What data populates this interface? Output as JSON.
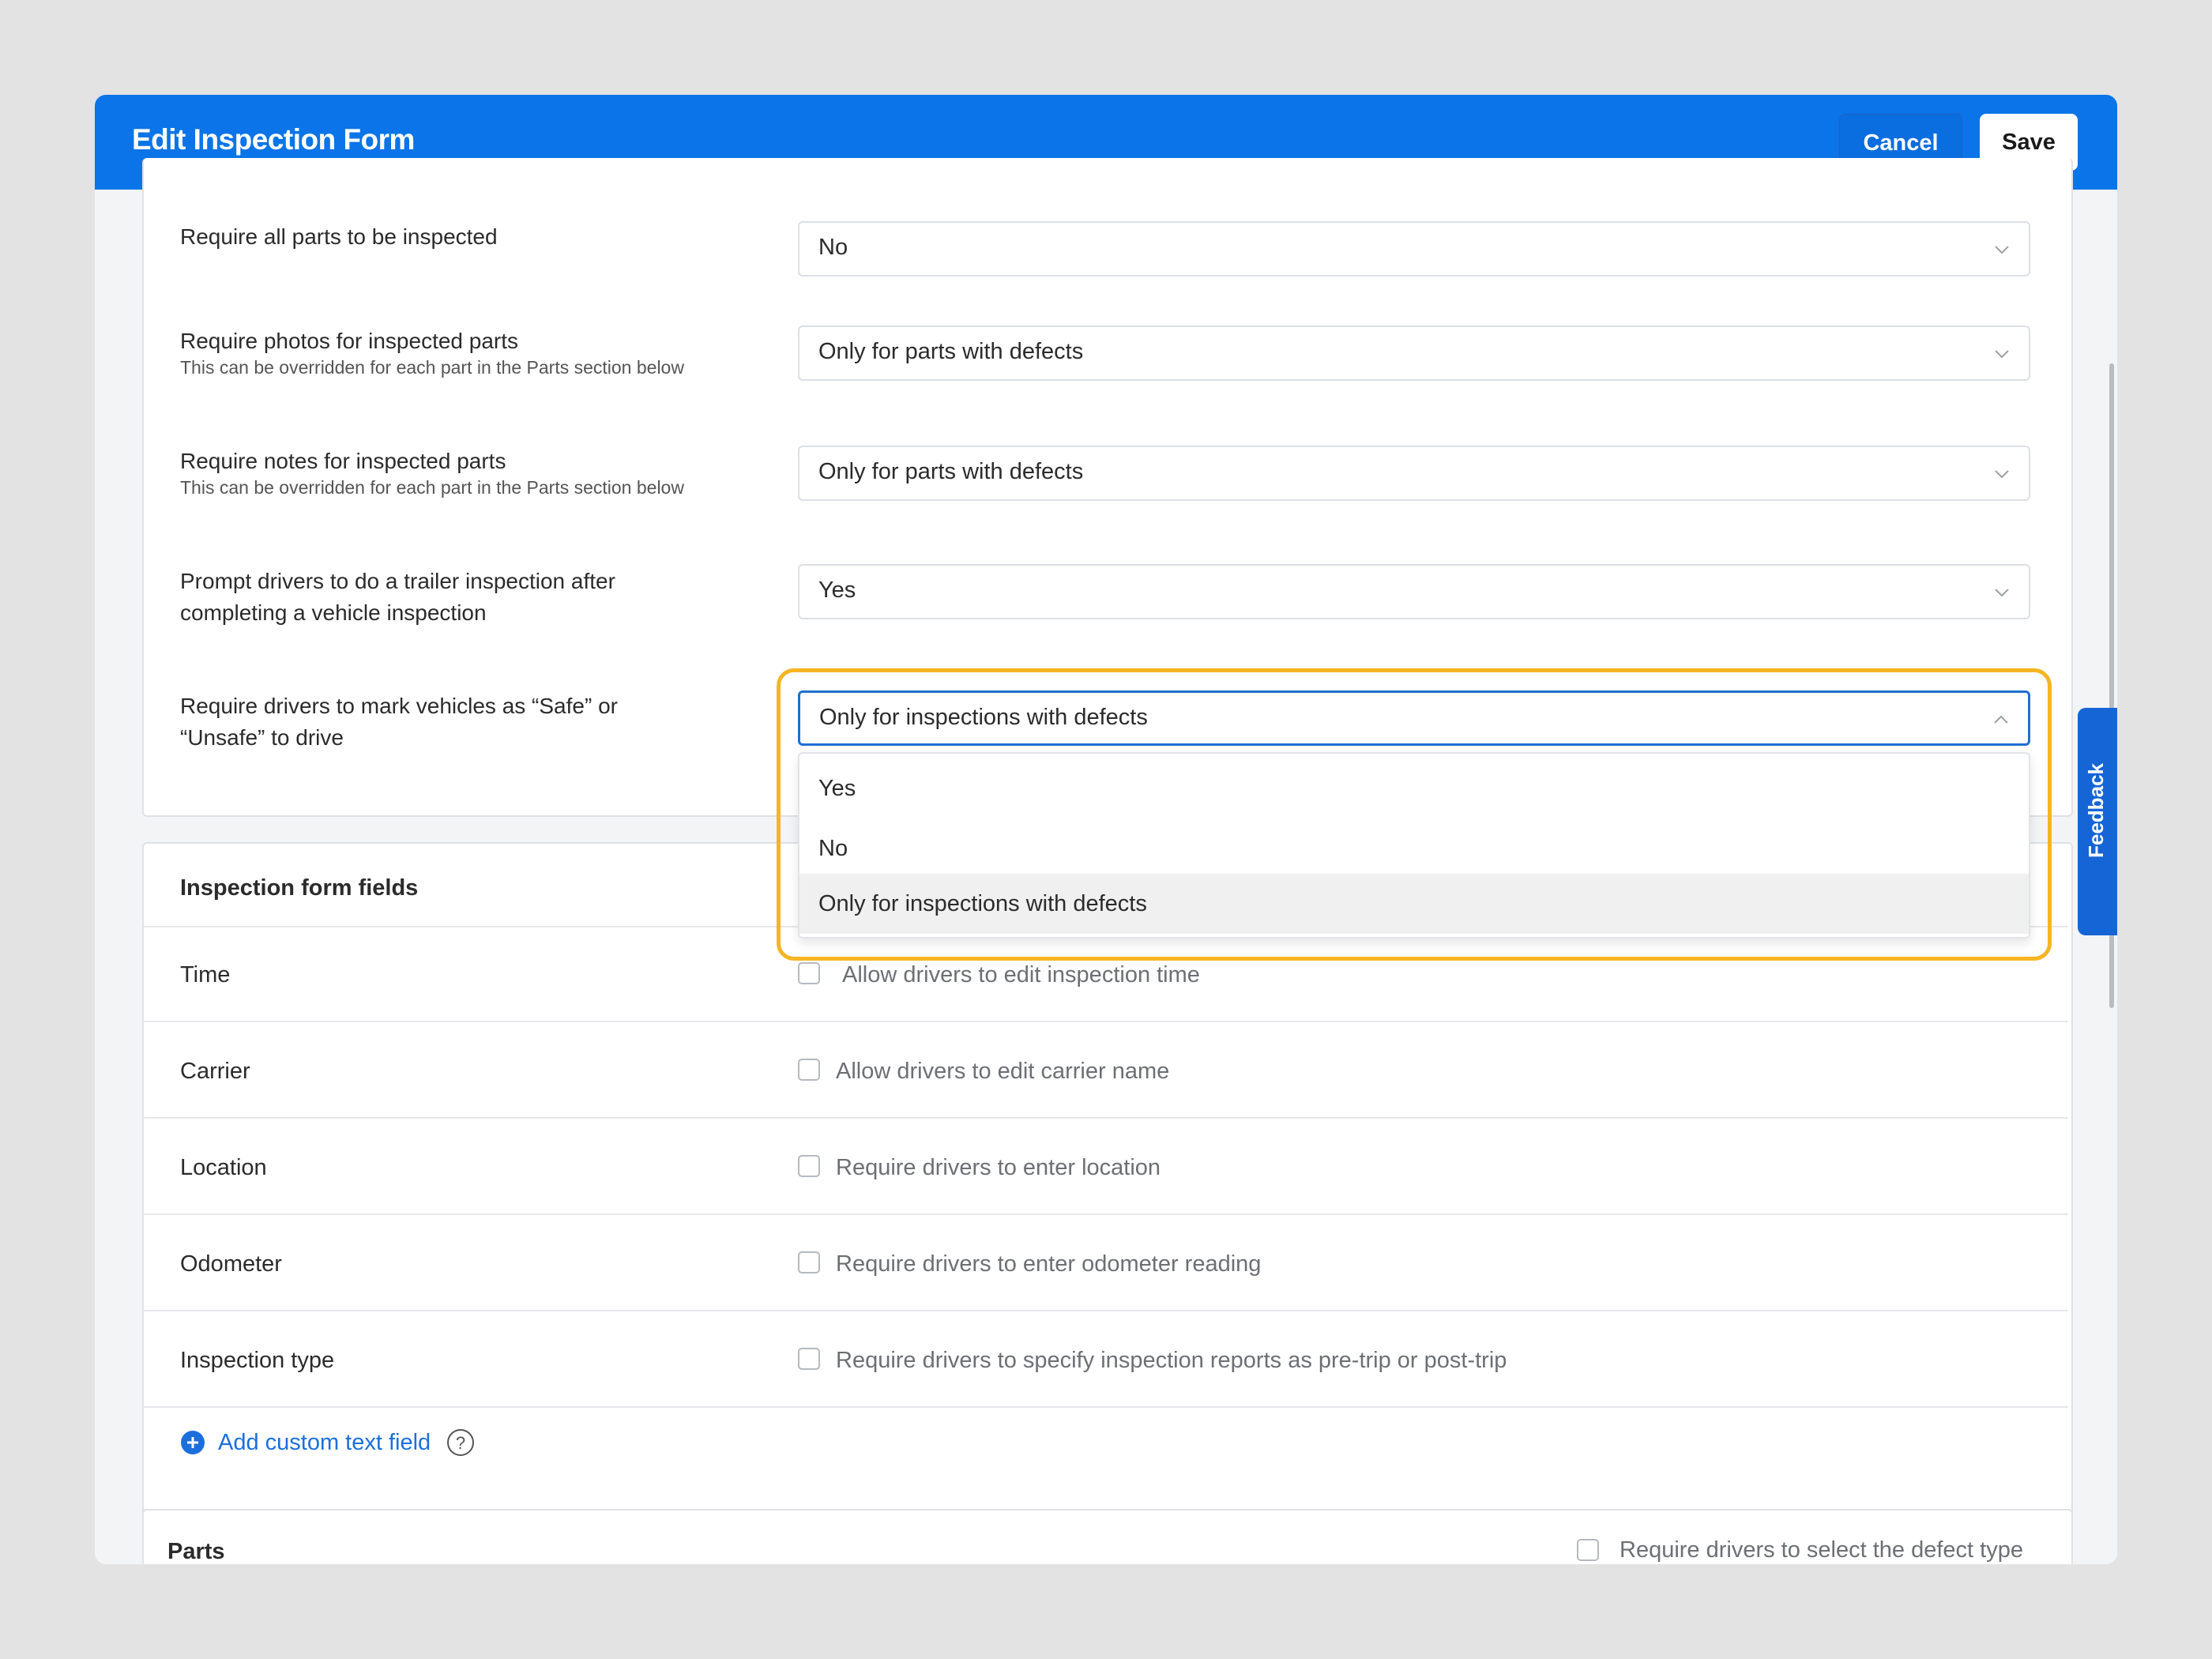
{
  "header": {
    "title": "Edit Inspection Form",
    "cancel_label": "Cancel",
    "save_label": "Save",
    "color": "#0a74e8"
  },
  "settings": [
    {
      "label": "Require all parts to be inspected",
      "sublabel": "",
      "value": "No"
    },
    {
      "label": "Require photos for inspected parts",
      "sublabel": "This can be overridden for each part in the Parts section below",
      "value": "Only for parts with defects"
    },
    {
      "label": "Require notes for inspected parts",
      "sublabel": "This can be overridden for each part in the Parts section below",
      "value": "Only for parts with defects"
    },
    {
      "label_line1": " Prompt drivers to do a trailer inspection after",
      "label_line2": "completing a vehicle inspection",
      "value": "Yes"
    },
    {
      "label_line1": "Require drivers to mark vehicles as “Safe” or",
      "label_line2": "“Unsafe” to drive",
      "value": "Only for inspections with defects"
    }
  ],
  "dropdown": {
    "options": [
      "Yes",
      "No",
      "Only for inspections with defects"
    ],
    "selected_index": 2
  },
  "fields_section": {
    "title": "Inspection form fields",
    "rows": [
      {
        "label": "Time",
        "checkbox_label": "Allow drivers to edit inspection time",
        "checked": false
      },
      {
        "label": "Carrier",
        "checkbox_label": "Allow drivers to edit carrier name",
        "checked": false
      },
      {
        "label": "Location",
        "checkbox_label": "Require drivers to enter location",
        "checked": false
      },
      {
        "label": "Odometer",
        "checkbox_label": "Require drivers to enter odometer reading",
        "checked": false
      },
      {
        "label": "Inspection type",
        "checkbox_label": "Require drivers to specify inspection reports as pre-trip or post-trip",
        "checked": false
      }
    ],
    "add_link": "Add custom text field"
  },
  "parts": {
    "title": "Parts",
    "checkbox_label": "Require drivers to select the defect type",
    "checked": false
  },
  "feedback": {
    "label": "Feedback"
  },
  "highlight_color": "#f5b522"
}
